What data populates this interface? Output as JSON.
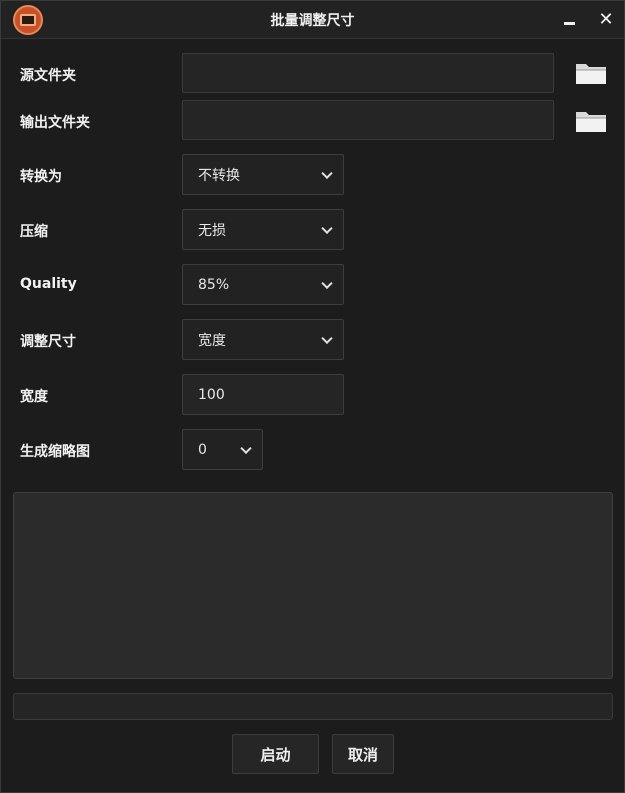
{
  "window": {
    "title": "批量调整尺寸"
  },
  "form": {
    "source_folder": {
      "label": "源文件夹",
      "value": ""
    },
    "output_folder": {
      "label": "输出文件夹",
      "value": ""
    },
    "convert_to": {
      "label": "转换为",
      "selected": "不转换"
    },
    "compression": {
      "label": "压缩",
      "selected": "无损"
    },
    "quality": {
      "label": "Quality",
      "selected": "85%"
    },
    "resize_mode": {
      "label": "调整尺寸",
      "selected": "宽度"
    },
    "width": {
      "label": "宽度",
      "value": "100"
    },
    "thumbnails": {
      "label": "生成缩略图",
      "selected": "0"
    }
  },
  "log": {
    "text": ""
  },
  "progress": {
    "fraction": 0
  },
  "buttons": {
    "start": "启动",
    "cancel": "取消"
  },
  "icons": {
    "folder": "folder-icon",
    "minimize": "minimize-icon",
    "close": "close-icon",
    "app": "app-logo-icon"
  },
  "colors": {
    "background": "#1c1c1c",
    "field": "#252525",
    "accent": "#c8502a"
  }
}
